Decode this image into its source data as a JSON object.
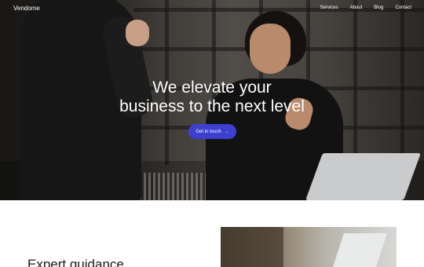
{
  "nav": {
    "brand": "Vendome",
    "links": [
      "Services",
      "About",
      "Blog",
      "Contact"
    ]
  },
  "hero": {
    "title_line1": "We elevate your",
    "title_line2": "business to the next level",
    "cta_label": "Get in touch",
    "cta_icon": "arrow-right-icon",
    "cta_glyph": "→"
  },
  "section": {
    "heading": "Expert guidance"
  },
  "colors": {
    "accent": "#3d3fcf",
    "text_light": "#ffffff",
    "text_dark": "#1a1a1a"
  }
}
